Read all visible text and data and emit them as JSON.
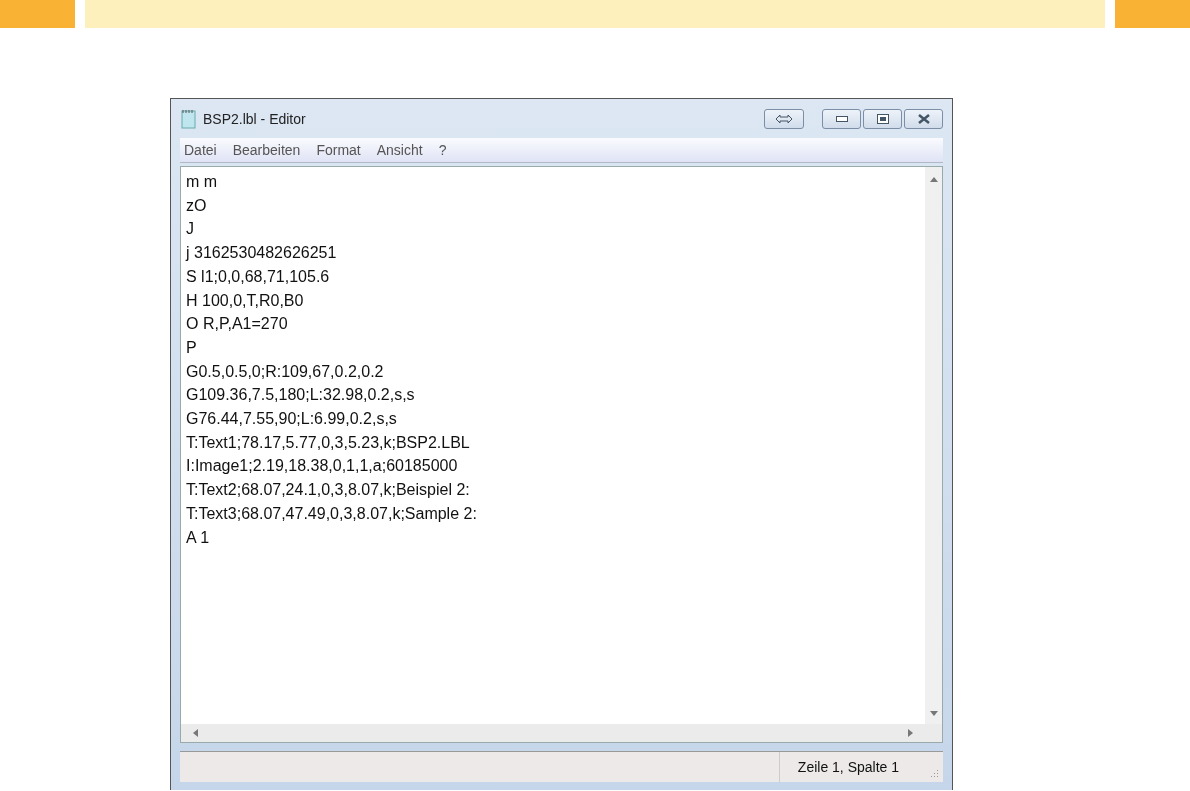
{
  "window": {
    "title": "BSP2.lbl - Editor"
  },
  "menu": [
    {
      "label": "Datei"
    },
    {
      "label": "Bearbeiten"
    },
    {
      "label": "Format"
    },
    {
      "label": "Ansicht"
    },
    {
      "label": "?"
    }
  ],
  "editor": {
    "lines": [
      "m m",
      "zO",
      "J",
      "j 3162530482626251",
      "S l1;0,0,68,71,105.6",
      "H 100,0,T,R0,B0",
      "O R,P,A1=270",
      "P",
      "G0.5,0.5,0;R:109,67,0.2,0.2",
      "G109.36,7.5,180;L:32.98,0.2,s,s",
      "G76.44,7.55,90;L:6.99,0.2,s,s",
      "T:Text1;78.17,5.77,0,3,5.23,k;BSP2.LBL",
      "I:Image1;2.19,18.38,0,1,1,a;60185000",
      "T:Text2;68.07,24.1,0,3,8.07,k;Beispiel 2:",
      "T:Text3;68.07,47.49,0,3,8.07,k;Sample 2:",
      "A 1"
    ]
  },
  "status_bar": {
    "position": "Zeile 1, Spalte 1"
  }
}
